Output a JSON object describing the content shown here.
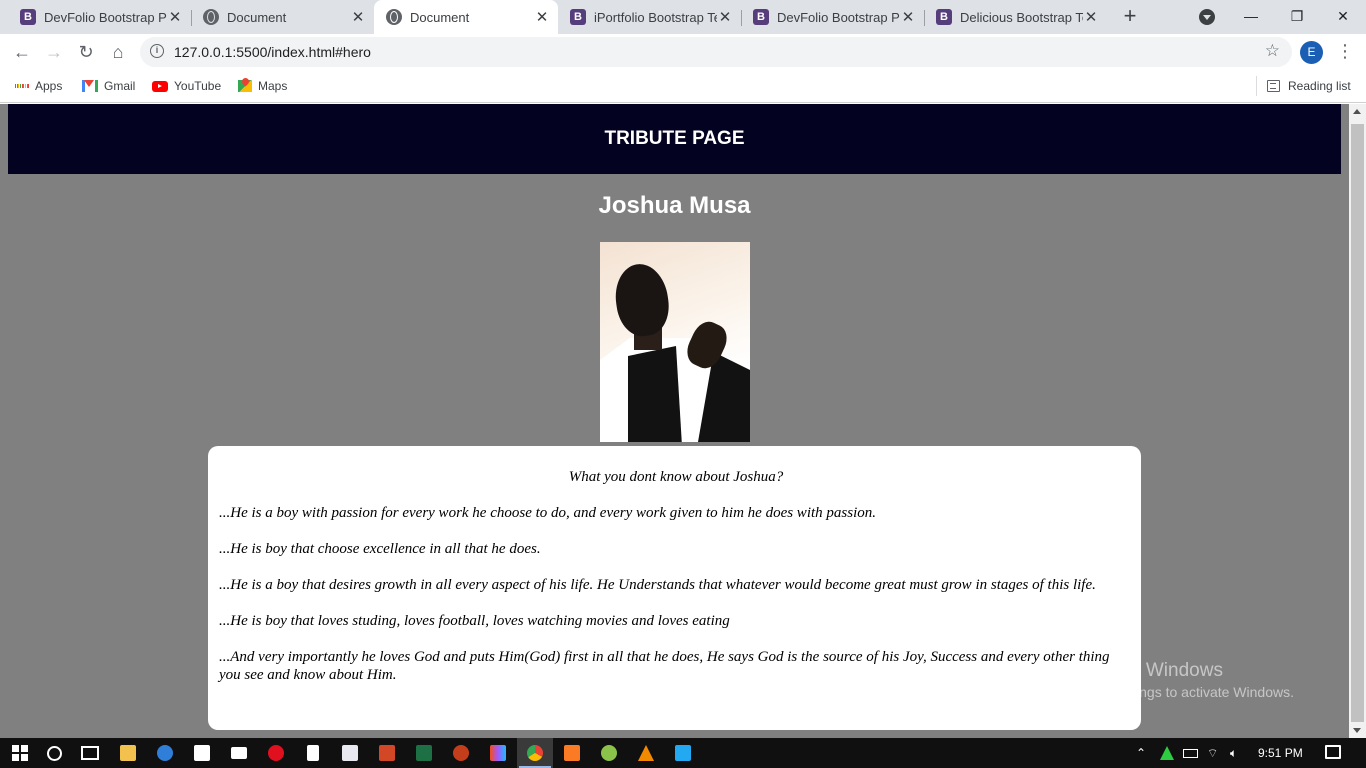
{
  "browser": {
    "tabs": [
      {
        "title": "DevFolio Bootstrap Po",
        "icon": "bootstrap-icon",
        "active": false
      },
      {
        "title": "Document",
        "icon": "globe-icon",
        "active": false
      },
      {
        "title": "Document",
        "icon": "globe-icon",
        "active": true
      },
      {
        "title": "iPortfolio Bootstrap Te",
        "icon": "bootstrap-icon",
        "active": false
      },
      {
        "title": "DevFolio Bootstrap Po",
        "icon": "bootstrap-icon",
        "active": false
      },
      {
        "title": "Delicious Bootstrap Te",
        "icon": "bootstrap-icon",
        "active": false
      }
    ],
    "tab_icon_letter": "B",
    "url": "127.0.0.1:5500/index.html#hero",
    "profile_initial": "E",
    "bookmarks": {
      "apps": "Apps",
      "gmail": "Gmail",
      "youtube": "YouTube",
      "maps": "Maps",
      "reading_list": "Reading list"
    }
  },
  "page": {
    "header_title": "TRIBUTE PAGE",
    "person_name": "Joshua Musa",
    "bio_question": "What you dont know about Joshua?",
    "bio_points": [
      "...He is a boy with passion for every work he choose to do, and every work given to him he does with passion.",
      "...He is boy that choose excellence in all that he does.",
      "...He is a boy that desires growth in all every aspect of his life. He Understands that whatever would become great must grow in stages of this life.",
      "...He is boy that loves studing, loves football, loves watching movies and loves eating",
      "...And very importantly he loves God and puts Him(God) first in all that he does, He says God is the source of his Joy, Success and every other thing you see and know about Him."
    ],
    "colors": {
      "header_bg": "#030220",
      "page_bg": "#808080",
      "card_bg": "#ffffff"
    }
  },
  "watermark": {
    "line1": "Activate Windows",
    "line2": "Go to Settings to activate Windows."
  },
  "taskbar": {
    "time": "9:51 PM"
  }
}
